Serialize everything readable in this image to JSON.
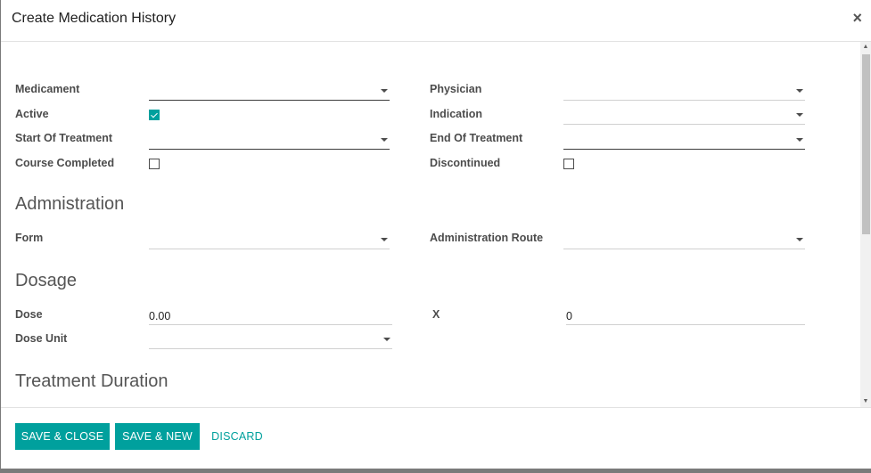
{
  "modal": {
    "title": "Create Medication History",
    "close_symbol": "×"
  },
  "form": {
    "medicament_label": "Medicament",
    "medicament_value": "",
    "physician_label": "Physician",
    "physician_value": "",
    "active_label": "Active",
    "active_checked": true,
    "indication_label": "Indication",
    "indication_value": "",
    "start_label": "Start Of Treatment",
    "start_value": "",
    "end_label": "End Of Treatment",
    "end_value": "",
    "course_completed_label": "Course Completed",
    "course_completed_checked": false,
    "discontinued_label": "Discontinued",
    "discontinued_checked": false
  },
  "administration": {
    "title": "Admnistration",
    "form_label": "Form",
    "form_value": "",
    "route_label": "Administration Route",
    "route_value": ""
  },
  "dosage": {
    "title": "Dosage",
    "dose_label": "Dose",
    "dose_value": "0.00",
    "x_label": "X",
    "x_value": "0",
    "dose_unit_label": "Dose Unit",
    "dose_unit_value": ""
  },
  "treatment_duration": {
    "title": "Treatment Duration"
  },
  "footer": {
    "save_close_label": "SAVE & CLOSE",
    "save_new_label": "SAVE & NEW",
    "discard_label": "DISCARD"
  },
  "colors": {
    "accent": "#00a09d",
    "backdrop": "#7a7a7a"
  },
  "icons": {
    "close": "close-icon",
    "dropdown": "chevron-down-icon",
    "checkbox": "checkbox-icon"
  }
}
